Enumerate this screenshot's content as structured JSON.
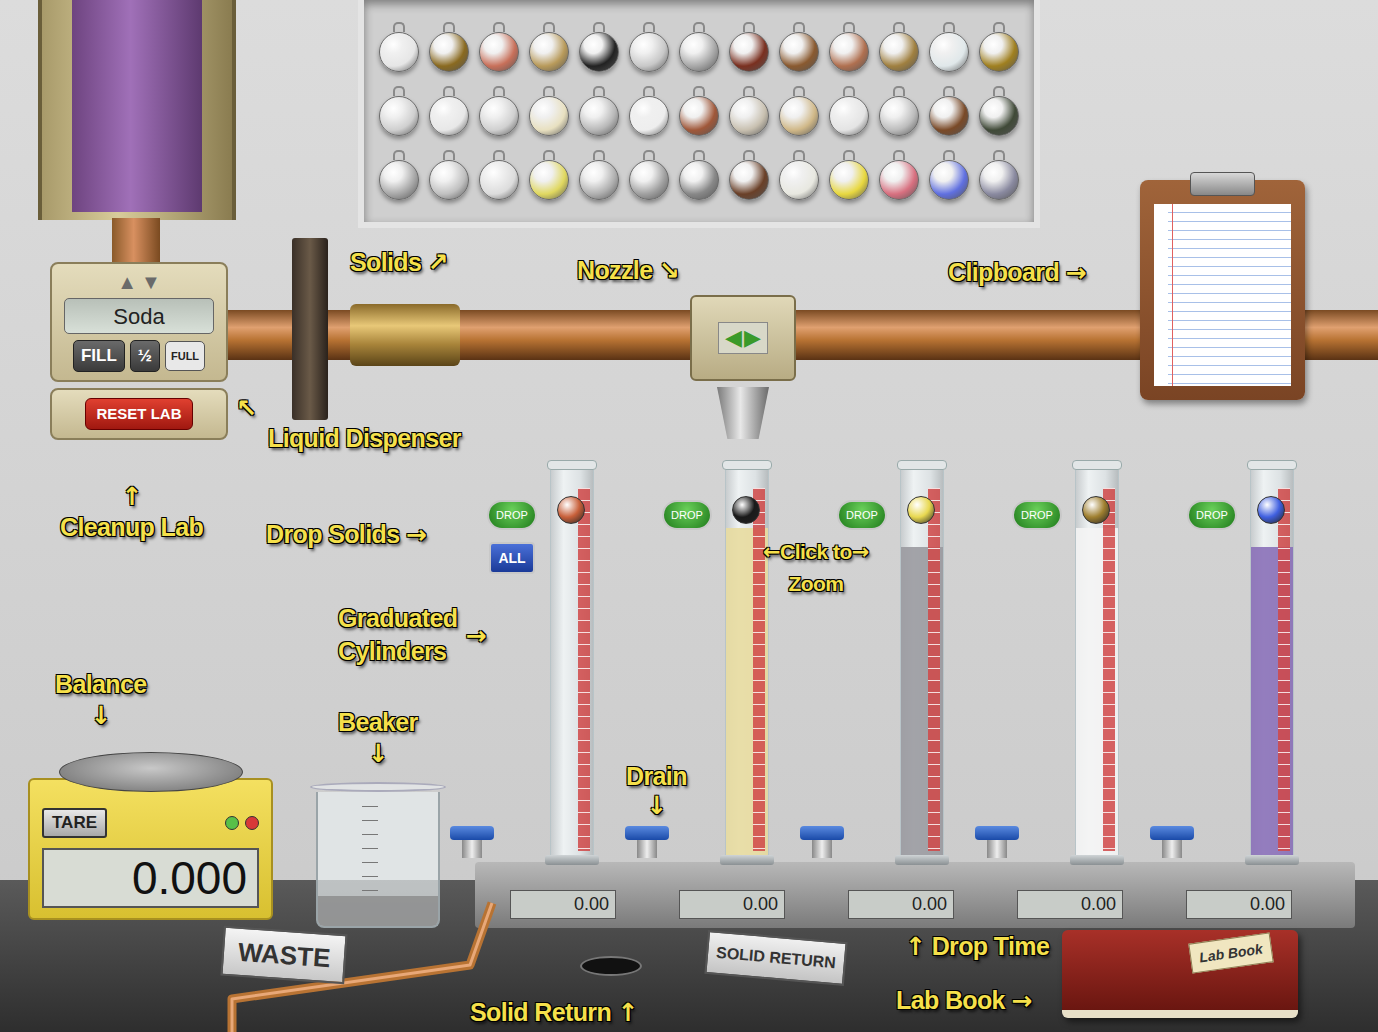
{
  "dispenser": {
    "up": "▲",
    "down": "▼",
    "liquid": "Soda",
    "buttons": [
      "FILL",
      "½",
      "FULL"
    ],
    "reset": "RESET LAB"
  },
  "nozzle": {
    "left": "◀",
    "right": "▶"
  },
  "solids": [
    {
      "color": "#e6e6e6"
    },
    {
      "color": "#8a6a20"
    },
    {
      "color": "#c8705a"
    },
    {
      "color": "#b89a5a"
    },
    {
      "color": "#222222"
    },
    {
      "color": "#c8c8c8"
    },
    {
      "color": "#a8a8a8"
    },
    {
      "color": "#7a3020"
    },
    {
      "color": "#8a5a30"
    },
    {
      "color": "#b07050"
    },
    {
      "color": "#a08040"
    },
    {
      "color": "#e0e8ea"
    },
    {
      "color": "#a08020"
    },
    {
      "color": "#cfcfcf"
    },
    {
      "color": "#e8e8e8"
    },
    {
      "color": "#d0d0d0"
    },
    {
      "color": "#e8e0c0"
    },
    {
      "color": "#b8b8b8"
    },
    {
      "color": "#eeeeee"
    },
    {
      "color": "#a0583a"
    },
    {
      "color": "#c8c0b0"
    },
    {
      "color": "#d0b888"
    },
    {
      "color": "#e4e4e4"
    },
    {
      "color": "#bcbcbc"
    },
    {
      "color": "#7a4a28"
    },
    {
      "color": "#404a38"
    },
    {
      "color": "#a8a8a8"
    },
    {
      "color": "#c0c0c0"
    },
    {
      "color": "#dcdcdc"
    },
    {
      "color": "#e0d860"
    },
    {
      "color": "#b0b0b0"
    },
    {
      "color": "#a0a0a0"
    },
    {
      "color": "#888888"
    },
    {
      "color": "#6a4028"
    },
    {
      "color": "#e8e8e0"
    },
    {
      "color": "#e8d840"
    },
    {
      "color": "#d87080"
    },
    {
      "color": "#6070e0"
    },
    {
      "color": "#8a8aa0"
    }
  ],
  "drop_all": "ALL",
  "cylinders": [
    {
      "drop": "DROP",
      "time": "0.00",
      "liquid_color": "#e8e8e8",
      "level": 0,
      "solid_color": "#c8603a"
    },
    {
      "drop": "DROP",
      "time": "0.00",
      "liquid_color": "#e8dca0",
      "level": 0.85,
      "solid_color": "#1a1a1a"
    },
    {
      "drop": "DROP",
      "time": "0.00",
      "liquid_color": "#9a9aa0",
      "level": 0.8,
      "solid_color": "#e8d850"
    },
    {
      "drop": "DROP",
      "time": "0.00",
      "liquid_color": "#f4f4f4",
      "level": 0.85,
      "solid_color": "#a08030"
    },
    {
      "drop": "DROP",
      "time": "0.00",
      "liquid_color": "#8a70b8",
      "level": 0.8,
      "solid_color": "#4060e0"
    }
  ],
  "balance": {
    "tare": "TARE",
    "reading": "0.000"
  },
  "signs": {
    "waste": "WASTE",
    "solid_return": "SOLID RETURN"
  },
  "lab_book": {
    "cover": "Lab Book"
  },
  "labels": {
    "solids": {
      "text": "Solids",
      "arrow": "↗"
    },
    "nozzle": {
      "text": "Nozzle",
      "arrow": "↘"
    },
    "clipboard": {
      "text": "Clipboard",
      "arrow": "→"
    },
    "liquid_dispenser": {
      "text": "Liquid Dispenser",
      "arrow": "↖"
    },
    "cleanup_lab": {
      "text": "Cleanup Lab",
      "arrow": "↑"
    },
    "drop_solids": {
      "text": "Drop Solids",
      "arrow": "→"
    },
    "click_to_zoom": {
      "text": "Click to",
      "line2": "Zoom",
      "arrow_left": "←",
      "arrow_right": "→"
    },
    "graduated_cylinders": {
      "text": "Graduated",
      "line2": "Cylinders",
      "arrow": "→"
    },
    "balance": {
      "text": "Balance",
      "arrow": "↓"
    },
    "beaker": {
      "text": "Beaker",
      "arrow": "↓"
    },
    "drain": {
      "text": "Drain",
      "arrow": "↓"
    },
    "drop_time": {
      "text": "Drop Time",
      "arrow": "↑"
    },
    "lab_book": {
      "text": "Lab Book",
      "arrow": "→"
    },
    "solid_return": {
      "text": "Solid Return",
      "arrow": "↑"
    }
  }
}
